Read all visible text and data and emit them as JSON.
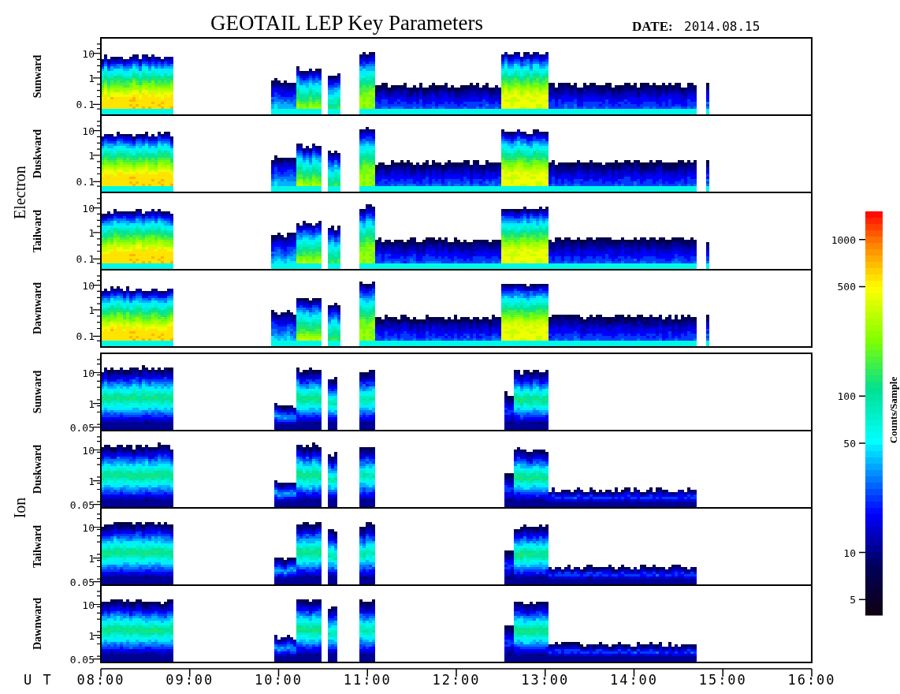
{
  "title": "GEOTAIL LEP Key Parameters",
  "date": {
    "label": "DATE:",
    "value": "2014.08.15"
  },
  "groups": [
    {
      "name": "Electron",
      "kind": "electron",
      "panels": [
        {
          "label": "Sunward",
          "yticks": [
            "10",
            "1",
            "0.1"
          ]
        },
        {
          "label": "Duskward",
          "yticks": [
            "10",
            "1",
            "0.1"
          ]
        },
        {
          "label": "Tailward",
          "yticks": [
            "10",
            "1",
            "0.1"
          ]
        },
        {
          "label": "Dawnward",
          "yticks": [
            "10",
            "1",
            "0.1"
          ]
        }
      ]
    },
    {
      "name": "Ion",
      "kind": "ion",
      "panels": [
        {
          "label": "Sunward",
          "yticks": [
            "10",
            "1",
            "0.05"
          ]
        },
        {
          "label": "Duskward",
          "yticks": [
            "10",
            "1",
            "0.05"
          ]
        },
        {
          "label": "Tailward",
          "yticks": [
            "10",
            "1",
            "0.05"
          ]
        },
        {
          "label": "Dawnward",
          "yticks": [
            "10",
            "1",
            "0.05"
          ]
        }
      ]
    }
  ],
  "x_axis": {
    "label": "U T",
    "ticks": [
      "08:00",
      "09:00",
      "10:00",
      "11:00",
      "12:00",
      "13:00",
      "14:00",
      "15:00",
      "16:00"
    ]
  },
  "colorbar": {
    "label": "Counts/Sample",
    "ticks": [
      "1000",
      "500",
      "100",
      "50",
      "10",
      "5"
    ]
  }
}
